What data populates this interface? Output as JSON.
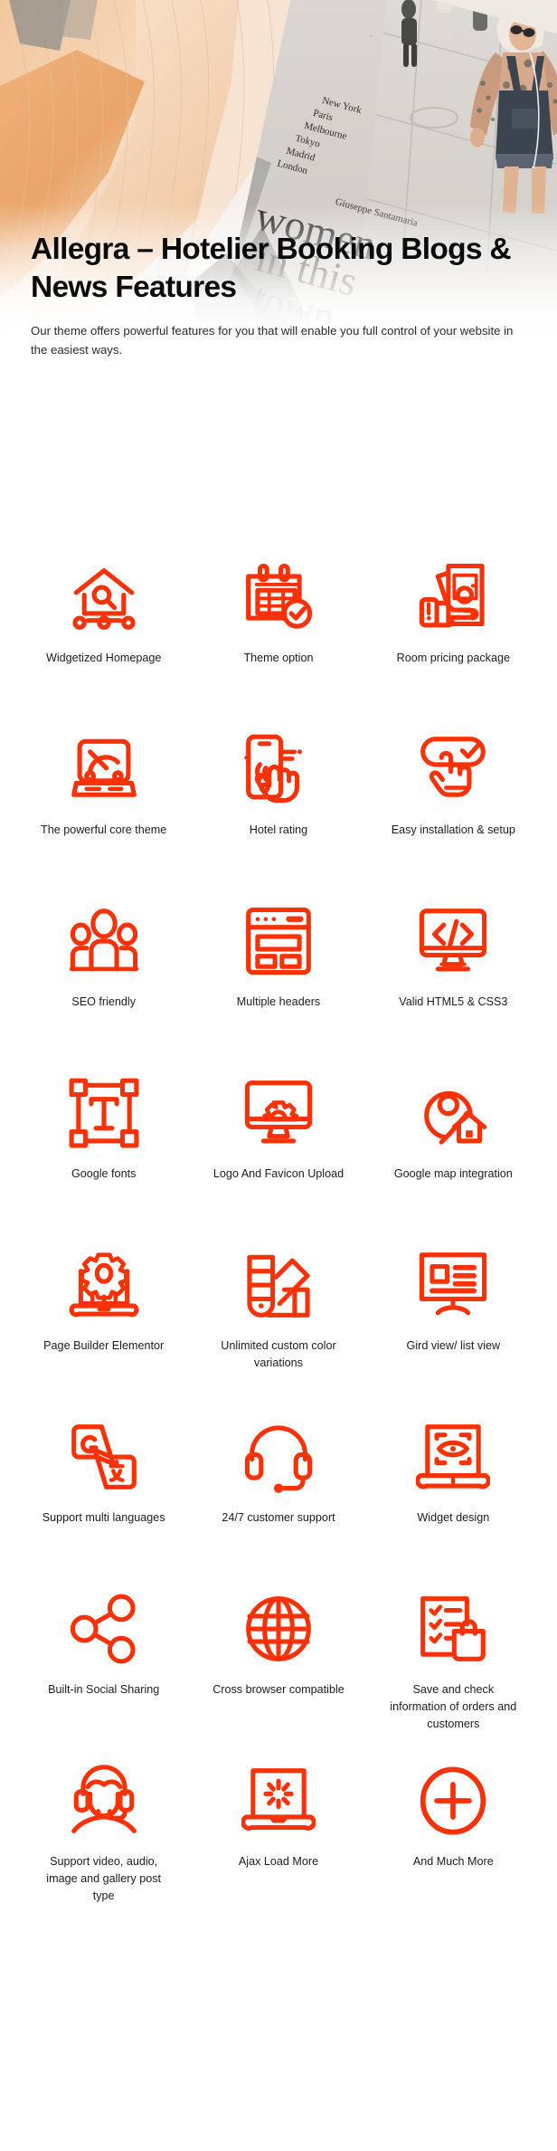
{
  "hero": {
    "alt": "Flatlay photo of pleated peach scarves beside a magazine titled women in this town",
    "magazine_title_lines": [
      "women",
      "in this",
      "town"
    ],
    "magazine_author": "Giuseppe Santamaria",
    "magazine_cities": [
      "New York",
      "Paris",
      "Melbourne",
      "Tokyo",
      "Madrid",
      "London"
    ]
  },
  "header": {
    "title": "Allegra – Hotelier Booking Blogs & News Features",
    "subtitle": "Our theme offers powerful features for you that will enable you full control of your website in the easiest ways."
  },
  "theme": {
    "accent": "#F73208",
    "title_color": "#0a0a0a",
    "body_color": "#2a2a2a",
    "background": "#ffffff"
  },
  "features": [
    {
      "label": "Widgetized Homepage",
      "icon": "home-search-icon"
    },
    {
      "label": "Theme option",
      "icon": "calendar-check-icon"
    },
    {
      "label": "Room pricing package",
      "icon": "hand-money-icon"
    },
    {
      "label": "The powerful core theme",
      "icon": "speedometer-icon"
    },
    {
      "label": "Hotel rating",
      "icon": "mobile-tap-icon"
    },
    {
      "label": "Easy installation & setup",
      "icon": "click-check-icon"
    },
    {
      "label": "SEO friendly",
      "icon": "people-group-icon"
    },
    {
      "label": "Multiple headers",
      "icon": "layout-header-icon"
    },
    {
      "label": "Valid HTML5 & CSS3",
      "icon": "code-monitor-icon"
    },
    {
      "label": "Google fonts",
      "icon": "text-transform-icon"
    },
    {
      "label": "Logo And Favicon Upload",
      "icon": "monitor-gear-icon"
    },
    {
      "label": "Google map integration",
      "icon": "map-pin-house-icon"
    },
    {
      "label": "Page Builder Elementor",
      "icon": "laptop-gear-icon"
    },
    {
      "label": "Unlimited custom color variations",
      "icon": "color-swatch-icon"
    },
    {
      "label": "Gird view/ list view",
      "icon": "monitor-list-icon"
    },
    {
      "label": "Support multi languages",
      "icon": "translate-icon"
    },
    {
      "label": "24/7 customer support",
      "icon": "headset-icon"
    },
    {
      "label": "Widget design",
      "icon": "laptop-eye-icon"
    },
    {
      "label": "Built-in Social Sharing",
      "icon": "share-nodes-icon"
    },
    {
      "label": "Cross browser compatible",
      "icon": "globe-icon"
    },
    {
      "label": "Save and check information of orders and customers",
      "icon": "checklist-bag-icon"
    },
    {
      "label": "Support video, audio, image and gallery post type",
      "icon": "support-person-icon"
    },
    {
      "label": "Ajax Load More",
      "icon": "laptop-loading-icon"
    },
    {
      "label": "And Much More",
      "icon": "plus-circle-icon"
    }
  ]
}
